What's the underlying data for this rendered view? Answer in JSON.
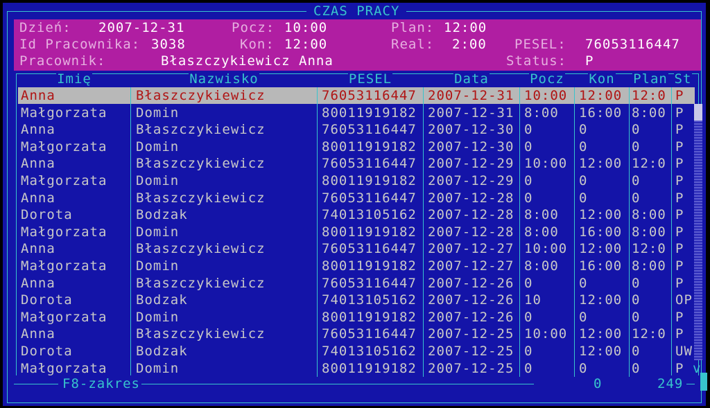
{
  "window": {
    "title": "CZAS PRACY"
  },
  "header": {
    "dzien_label": "Dzień:",
    "dzien": "2007-12-31",
    "pocz_label": "Pocz:",
    "pocz": "10:00",
    "plan_label": "Plan:",
    "plan": "12:00",
    "id_label": "Id Pracownika:",
    "id": "3038",
    "kon_label": "Kon:",
    "kon": "12:00",
    "real_label": "Real:",
    "real": "2:00",
    "pesel_label": "PESEL:",
    "pesel": "76053116447",
    "pracownik_label": "Pracownik:",
    "pracownik": "Błaszczykiewicz Anna",
    "status_label": "Status:",
    "status": "P"
  },
  "columns": [
    "Imię",
    "Nazwisko",
    "PESEL",
    "Data",
    "Pocz",
    "Kon",
    "Plan",
    "St"
  ],
  "rows": [
    [
      "Anna",
      "Błaszczykiewicz",
      "76053116447",
      "2007-12-31",
      "10:00",
      "12:00",
      "12:0",
      "P"
    ],
    [
      "Małgorzata",
      "Domin",
      "80011919182",
      "2007-12-31",
      "8:00",
      "16:00",
      "8:00",
      "P"
    ],
    [
      "Anna",
      "Błaszczykiewicz",
      "76053116447",
      "2007-12-30",
      "0",
      "0",
      "0",
      "P"
    ],
    [
      "Małgorzata",
      "Domin",
      "80011919182",
      "2007-12-30",
      "0",
      "0",
      "0",
      "P"
    ],
    [
      "Anna",
      "Błaszczykiewicz",
      "76053116447",
      "2007-12-29",
      "10:00",
      "12:00",
      "12:0",
      "P"
    ],
    [
      "Małgorzata",
      "Domin",
      "80011919182",
      "2007-12-29",
      "0",
      "0",
      "0",
      "P"
    ],
    [
      "Anna",
      "Błaszczykiewicz",
      "76053116447",
      "2007-12-28",
      "0",
      "0",
      "0",
      "P"
    ],
    [
      "Dorota",
      "Bodzak",
      "74013105162",
      "2007-12-28",
      "8:00",
      "12:00",
      "8:00",
      "P"
    ],
    [
      "Małgorzata",
      "Domin",
      "80011919182",
      "2007-12-28",
      "8:00",
      "16:00",
      "8:00",
      "P"
    ],
    [
      "Anna",
      "Błaszczykiewicz",
      "76053116447",
      "2007-12-27",
      "10:00",
      "12:00",
      "12:0",
      "P"
    ],
    [
      "Małgorzata",
      "Domin",
      "80011919182",
      "2007-12-27",
      "8:00",
      "16:00",
      "8:00",
      "P"
    ],
    [
      "Anna",
      "Błaszczykiewicz",
      "76053116447",
      "2007-12-26",
      "0",
      "0",
      "0",
      "P"
    ],
    [
      "Dorota",
      "Bodzak",
      "74013105162",
      "2007-12-26",
      "10",
      "12:00",
      "0",
      "OP"
    ],
    [
      "Małgorzata",
      "Domin",
      "80011919182",
      "2007-12-26",
      "0",
      "0",
      "0",
      "P"
    ],
    [
      "Anna",
      "Błaszczykiewicz",
      "76053116447",
      "2007-12-25",
      "10:00",
      "12:00",
      "12:0",
      "P"
    ],
    [
      "Dorota",
      "Bodzak",
      "74013105162",
      "2007-12-25",
      "0",
      "12:00",
      "0",
      "UW"
    ],
    [
      "Małgorzata",
      "Domin",
      "80011919182",
      "2007-12-25",
      "0",
      "0",
      "0",
      "P"
    ]
  ],
  "selected_row": 0,
  "footer": {
    "key": "F8",
    "key_label": "-zakres",
    "range_start": "0",
    "range_end": "249"
  },
  "scrollbar": {
    "down_arrow": "v"
  },
  "colors": {
    "background": "#1414a8",
    "header": "#b01ea2",
    "accent": "#38c4cc",
    "selection": "#b8b8b8",
    "selection_text": "#b01414"
  }
}
